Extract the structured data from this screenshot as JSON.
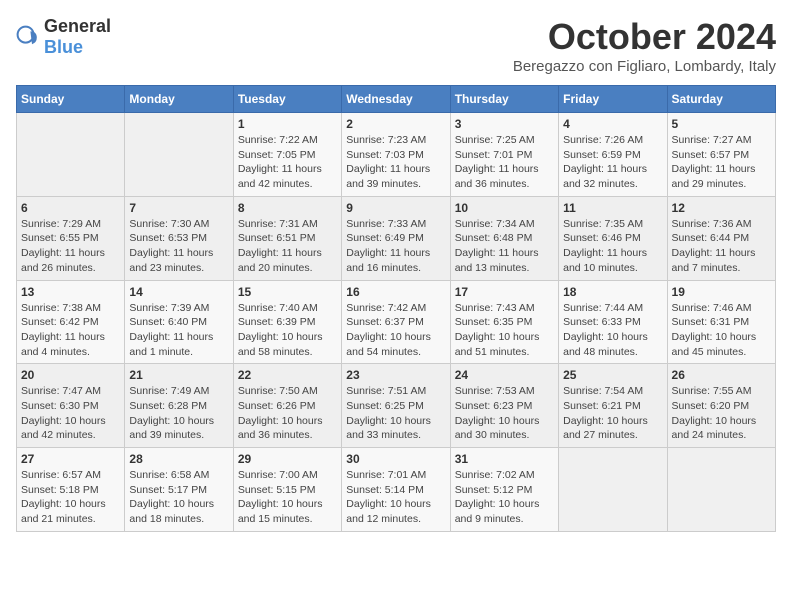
{
  "logo": {
    "general": "General",
    "blue": "Blue"
  },
  "header": {
    "month": "October 2024",
    "location": "Beregazzo con Figliaro, Lombardy, Italy"
  },
  "weekdays": [
    "Sunday",
    "Monday",
    "Tuesday",
    "Wednesday",
    "Thursday",
    "Friday",
    "Saturday"
  ],
  "weeks": [
    [
      {
        "day": "",
        "detail": ""
      },
      {
        "day": "",
        "detail": ""
      },
      {
        "day": "1",
        "detail": "Sunrise: 7:22 AM\nSunset: 7:05 PM\nDaylight: 11 hours and 42 minutes."
      },
      {
        "day": "2",
        "detail": "Sunrise: 7:23 AM\nSunset: 7:03 PM\nDaylight: 11 hours and 39 minutes."
      },
      {
        "day": "3",
        "detail": "Sunrise: 7:25 AM\nSunset: 7:01 PM\nDaylight: 11 hours and 36 minutes."
      },
      {
        "day": "4",
        "detail": "Sunrise: 7:26 AM\nSunset: 6:59 PM\nDaylight: 11 hours and 32 minutes."
      },
      {
        "day": "5",
        "detail": "Sunrise: 7:27 AM\nSunset: 6:57 PM\nDaylight: 11 hours and 29 minutes."
      }
    ],
    [
      {
        "day": "6",
        "detail": "Sunrise: 7:29 AM\nSunset: 6:55 PM\nDaylight: 11 hours and 26 minutes."
      },
      {
        "day": "7",
        "detail": "Sunrise: 7:30 AM\nSunset: 6:53 PM\nDaylight: 11 hours and 23 minutes."
      },
      {
        "day": "8",
        "detail": "Sunrise: 7:31 AM\nSunset: 6:51 PM\nDaylight: 11 hours and 20 minutes."
      },
      {
        "day": "9",
        "detail": "Sunrise: 7:33 AM\nSunset: 6:49 PM\nDaylight: 11 hours and 16 minutes."
      },
      {
        "day": "10",
        "detail": "Sunrise: 7:34 AM\nSunset: 6:48 PM\nDaylight: 11 hours and 13 minutes."
      },
      {
        "day": "11",
        "detail": "Sunrise: 7:35 AM\nSunset: 6:46 PM\nDaylight: 11 hours and 10 minutes."
      },
      {
        "day": "12",
        "detail": "Sunrise: 7:36 AM\nSunset: 6:44 PM\nDaylight: 11 hours and 7 minutes."
      }
    ],
    [
      {
        "day": "13",
        "detail": "Sunrise: 7:38 AM\nSunset: 6:42 PM\nDaylight: 11 hours and 4 minutes."
      },
      {
        "day": "14",
        "detail": "Sunrise: 7:39 AM\nSunset: 6:40 PM\nDaylight: 11 hours and 1 minute."
      },
      {
        "day": "15",
        "detail": "Sunrise: 7:40 AM\nSunset: 6:39 PM\nDaylight: 10 hours and 58 minutes."
      },
      {
        "day": "16",
        "detail": "Sunrise: 7:42 AM\nSunset: 6:37 PM\nDaylight: 10 hours and 54 minutes."
      },
      {
        "day": "17",
        "detail": "Sunrise: 7:43 AM\nSunset: 6:35 PM\nDaylight: 10 hours and 51 minutes."
      },
      {
        "day": "18",
        "detail": "Sunrise: 7:44 AM\nSunset: 6:33 PM\nDaylight: 10 hours and 48 minutes."
      },
      {
        "day": "19",
        "detail": "Sunrise: 7:46 AM\nSunset: 6:31 PM\nDaylight: 10 hours and 45 minutes."
      }
    ],
    [
      {
        "day": "20",
        "detail": "Sunrise: 7:47 AM\nSunset: 6:30 PM\nDaylight: 10 hours and 42 minutes."
      },
      {
        "day": "21",
        "detail": "Sunrise: 7:49 AM\nSunset: 6:28 PM\nDaylight: 10 hours and 39 minutes."
      },
      {
        "day": "22",
        "detail": "Sunrise: 7:50 AM\nSunset: 6:26 PM\nDaylight: 10 hours and 36 minutes."
      },
      {
        "day": "23",
        "detail": "Sunrise: 7:51 AM\nSunset: 6:25 PM\nDaylight: 10 hours and 33 minutes."
      },
      {
        "day": "24",
        "detail": "Sunrise: 7:53 AM\nSunset: 6:23 PM\nDaylight: 10 hours and 30 minutes."
      },
      {
        "day": "25",
        "detail": "Sunrise: 7:54 AM\nSunset: 6:21 PM\nDaylight: 10 hours and 27 minutes."
      },
      {
        "day": "26",
        "detail": "Sunrise: 7:55 AM\nSunset: 6:20 PM\nDaylight: 10 hours and 24 minutes."
      }
    ],
    [
      {
        "day": "27",
        "detail": "Sunrise: 6:57 AM\nSunset: 5:18 PM\nDaylight: 10 hours and 21 minutes."
      },
      {
        "day": "28",
        "detail": "Sunrise: 6:58 AM\nSunset: 5:17 PM\nDaylight: 10 hours and 18 minutes."
      },
      {
        "day": "29",
        "detail": "Sunrise: 7:00 AM\nSunset: 5:15 PM\nDaylight: 10 hours and 15 minutes."
      },
      {
        "day": "30",
        "detail": "Sunrise: 7:01 AM\nSunset: 5:14 PM\nDaylight: 10 hours and 12 minutes."
      },
      {
        "day": "31",
        "detail": "Sunrise: 7:02 AM\nSunset: 5:12 PM\nDaylight: 10 hours and 9 minutes."
      },
      {
        "day": "",
        "detail": ""
      },
      {
        "day": "",
        "detail": ""
      }
    ]
  ]
}
